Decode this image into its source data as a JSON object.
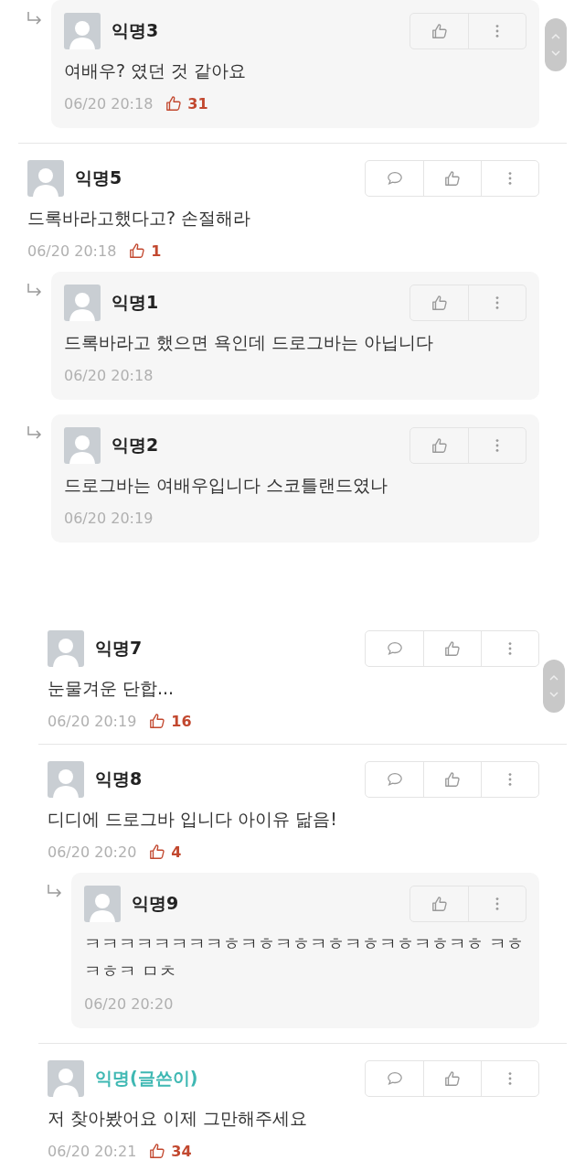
{
  "panels": [
    {
      "comments": [
        {
          "kind": "reply",
          "author": "익명3",
          "op": false,
          "text": "여배우? 였던 것 같아요",
          "time": "06/20 20:18",
          "likes": "31"
        },
        {
          "kind": "comment",
          "author": "익명5",
          "op": false,
          "text": "드록바라고했다고? 손절해라",
          "time": "06/20 20:18",
          "likes": "1"
        },
        {
          "kind": "reply",
          "author": "익명1",
          "op": false,
          "text": "드록바라고 했으면 욕인데 드로그바는 아닙니다",
          "time": "06/20 20:18"
        },
        {
          "kind": "reply",
          "author": "익명2",
          "op": false,
          "text": "드로그바는 여배우입니다 스코틀랜드였나",
          "time": "06/20 20:19"
        }
      ]
    },
    {
      "comments": [
        {
          "kind": "comment",
          "author": "익명7",
          "op": false,
          "text": "눈물겨운 단합...",
          "time": "06/20 20:19",
          "likes": "16"
        },
        {
          "kind": "comment",
          "author": "익명8",
          "op": false,
          "text": "디디에 드로그바 입니다 아이유 닮음!",
          "time": "06/20 20:20",
          "likes": "4"
        },
        {
          "kind": "reply",
          "author": "익명9",
          "op": false,
          "text": "ㅋㅋㅋㅋㅋㅋㅋㅋㅎㅋㅎㅋㅎㅋㅎㅋㅎㅋㅎㅋㅎㅋㅎ ㅋㅎㅋㅎㅋ ㅁㅊ",
          "time": "06/20 20:20"
        },
        {
          "kind": "comment",
          "author": "익명(글쓴이)",
          "op": true,
          "text": "저 찾아봤어요 이제 그만해주세요",
          "time": "06/20 20:21",
          "likes": "34"
        }
      ]
    }
  ]
}
